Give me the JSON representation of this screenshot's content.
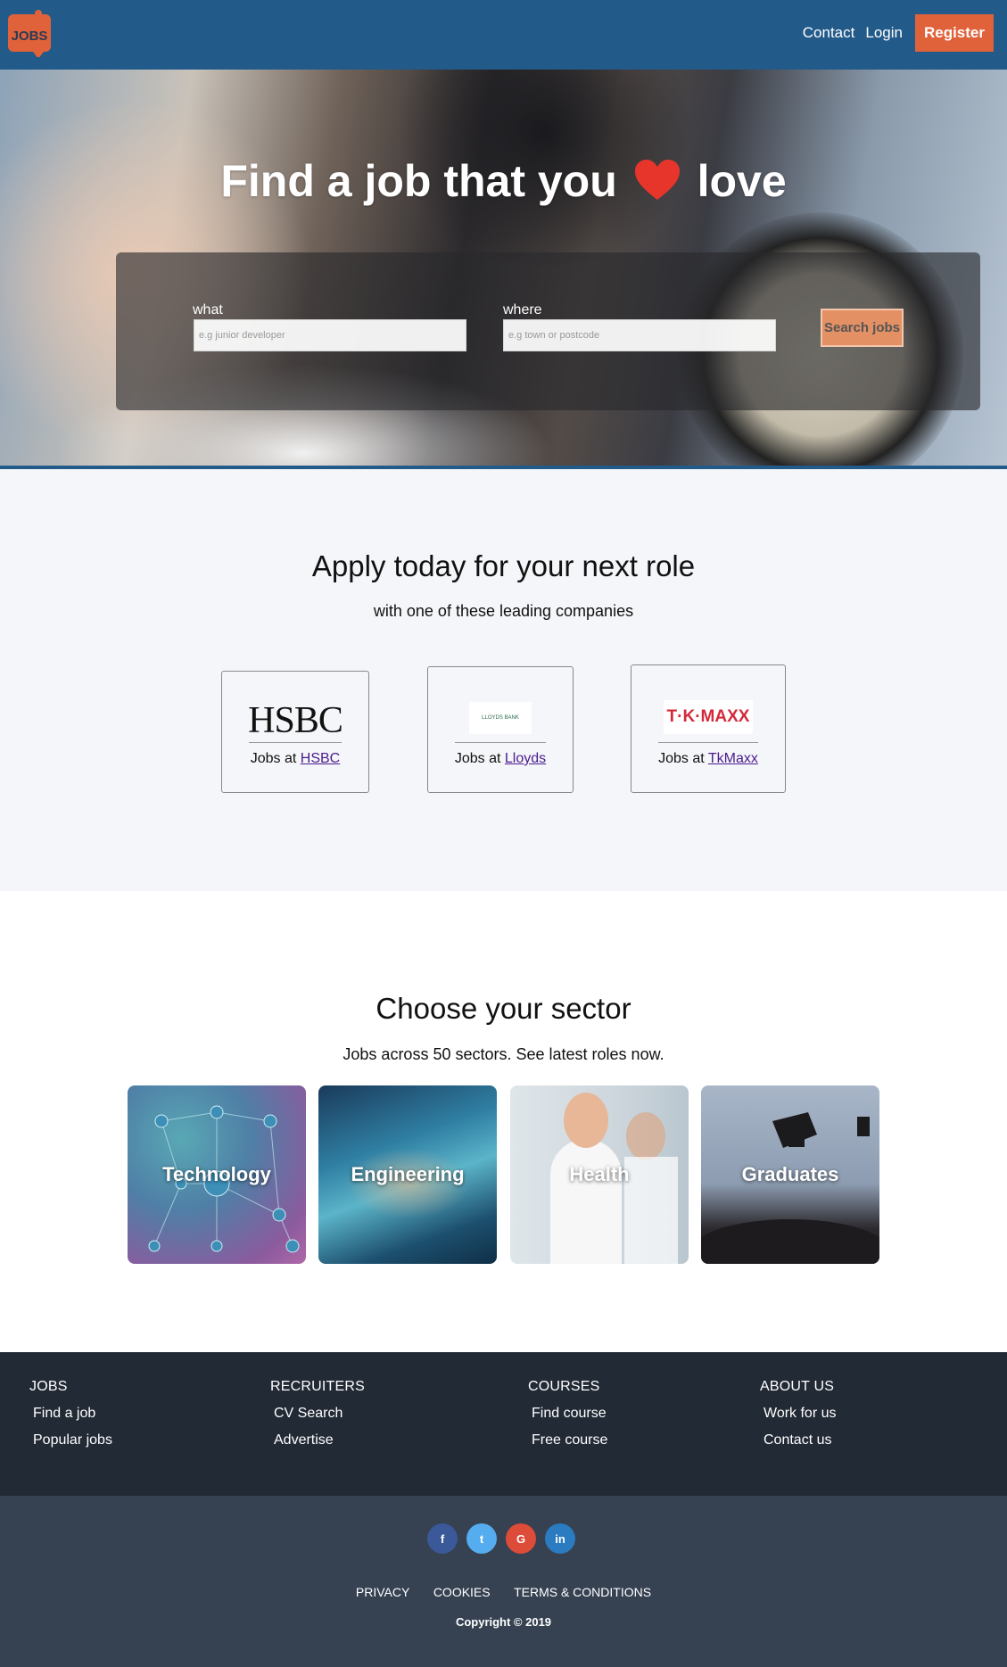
{
  "header": {
    "logo_text": "JOBS",
    "nav": {
      "contact": "Contact",
      "login": "Login",
      "register": "Register"
    }
  },
  "hero": {
    "title_start": "Find a job that you",
    "title_end": "love",
    "what_label": "what",
    "what_placeholder": "e.g junior developer",
    "where_label": "where",
    "where_placeholder": "e.g town or postcode",
    "search_button": "Search jobs"
  },
  "companies": {
    "title": "Apply today for your next role",
    "subtitle": "with one of these leading companies",
    "items": [
      {
        "logo": "HSBC",
        "prefix": "Jobs at ",
        "link": "HSBC"
      },
      {
        "logo": "LLOYDS BANK",
        "prefix": "Jobs at ",
        "link": "Lloyds"
      },
      {
        "logo": "T·K·MAXX",
        "prefix": "Jobs at ",
        "link": "TkMaxx"
      }
    ]
  },
  "sectors": {
    "title": "Choose your sector",
    "subtitle": "Jobs across 50 sectors. See latest roles now.",
    "items": [
      "Technology",
      "Engineering",
      "Health",
      "Graduates"
    ]
  },
  "footer": {
    "columns": [
      {
        "heading": "JOBS",
        "links": [
          "Find a job",
          "Popular jobs"
        ]
      },
      {
        "heading": "RECRUITERS",
        "links": [
          "CV Search",
          "Advertise"
        ]
      },
      {
        "heading": "COURSES",
        "links": [
          "Find course",
          "Free course"
        ]
      },
      {
        "heading": "ABOUT US",
        "links": [
          "Work for us",
          "Contact us"
        ]
      }
    ],
    "social": [
      "f",
      "t",
      "G",
      "in"
    ],
    "legal": [
      "PRIVACY",
      "COOKIES",
      "TERMS & CONDITIONS"
    ],
    "copyright": "Copyright © 2019"
  },
  "colors": {
    "brand_blue": "#225a89",
    "accent_orange": "#e0623a",
    "heart_red": "#e8352b",
    "footer_dark": "#222a35",
    "footer_bottom": "#364152"
  }
}
